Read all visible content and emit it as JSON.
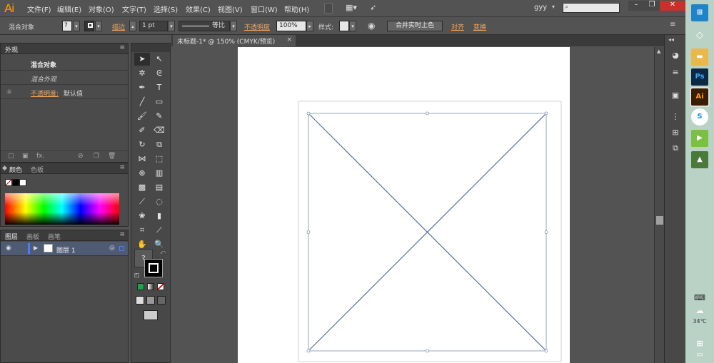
{
  "app": {
    "logo": "Ai"
  },
  "menu": [
    "文件(F)",
    "编辑(E)",
    "对象(O)",
    "文字(T)",
    "选择(S)",
    "效果(C)",
    "视图(V)",
    "窗口(W)",
    "帮助(H)"
  ],
  "user": {
    "name": "gyy",
    "arrow": "▾"
  },
  "window_controls": {
    "minimize": "–",
    "restore": "❐",
    "close": "✕"
  },
  "control_bar": {
    "object_type": "混合对象",
    "fill_value": "?",
    "stroke_label": "描边",
    "stroke_weight": "1 pt",
    "profile": "等比",
    "opacity_label": "不透明度",
    "opacity_value": "100%",
    "style_label": "样式:",
    "merge_button": "合并实时上色",
    "align_link": "对齐",
    "transform_link": "变换"
  },
  "appearance_panel": {
    "tab": "外观",
    "rows": [
      {
        "label": "混合对象"
      },
      {
        "label": "混合外观"
      },
      {
        "link": "不透明度:",
        "value": "默认值"
      }
    ],
    "fx_label": "fx."
  },
  "color_panel": {
    "tabs": [
      "颜色",
      "色板"
    ]
  },
  "layers_panel": {
    "tabs": [
      "图层",
      "画板",
      "画笔"
    ],
    "layer_name": "图层 1"
  },
  "document": {
    "tab_title": "未标题-1* @ 150% (CMYK/预览)",
    "close": "×"
  },
  "tools": {
    "fill_question": "?"
  },
  "taskbar": {
    "apps": [
      "Ps",
      "Ai",
      "S"
    ],
    "weather": "34℃"
  },
  "colors": {
    "accent_orange": "#f1a55b",
    "selection_blue": "#4f5a73",
    "path_blue": "#5a6f96"
  }
}
